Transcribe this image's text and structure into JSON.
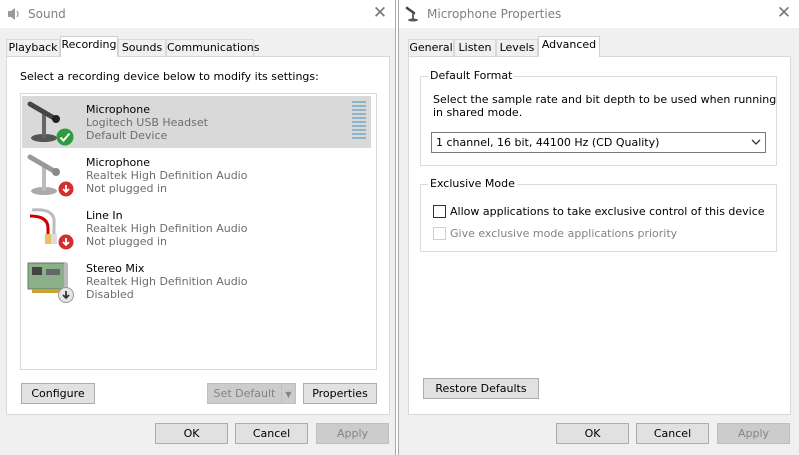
{
  "sound": {
    "title": "Sound",
    "tabs": [
      "Playback",
      "Recording",
      "Sounds",
      "Communications"
    ],
    "active_tab": "Recording",
    "instruction": "Select a recording device below to modify its settings:",
    "devices": [
      {
        "name": "Microphone",
        "description": "Logitech USB Headset",
        "status": "Default Device",
        "icon": "headset-microphone-icon",
        "badge": "green-check-badge"
      },
      {
        "name": "Microphone",
        "description": "Realtek High Definition Audio",
        "status": "Not plugged in",
        "icon": "desk-microphone-icon",
        "badge": "red-down-arrow-badge"
      },
      {
        "name": "Line In",
        "description": "Realtek High Definition Audio",
        "status": "Not plugged in",
        "icon": "line-in-cable-icon",
        "badge": "red-down-arrow-badge"
      },
      {
        "name": "Stereo Mix",
        "description": "Realtek High Definition Audio",
        "status": "Disabled",
        "icon": "sound-card-icon",
        "badge": "gray-down-arrow-badge"
      }
    ],
    "buttons": {
      "configure": "Configure",
      "set_default": "Set Default",
      "properties": "Properties",
      "ok": "OK",
      "cancel": "Cancel",
      "apply": "Apply"
    }
  },
  "mic": {
    "title": "Microphone Properties",
    "tabs": [
      "General",
      "Listen",
      "Levels",
      "Advanced"
    ],
    "active_tab": "Advanced",
    "default_format": {
      "title": "Default Format",
      "description_line1": "Select the sample rate and bit depth to be used when running",
      "description_line2": "in shared mode.",
      "selected": "1 channel, 16 bit, 44100 Hz (CD Quality)"
    },
    "exclusive_mode": {
      "title": "Exclusive Mode",
      "allow_label": "Allow applications to take exclusive control of this device",
      "allow_checked": false,
      "priority_label": "Give exclusive mode applications priority",
      "priority_checked": false,
      "priority_enabled": false
    },
    "buttons": {
      "restore": "Restore Defaults",
      "ok": "OK",
      "cancel": "Cancel",
      "apply": "Apply"
    }
  },
  "colors": {
    "selection": "#d9d9d9",
    "window_bg": "#f0f0f0",
    "disabled_text": "#838383",
    "check_green": "#2e9c3c",
    "unplugged_red": "#d32f2f"
  }
}
